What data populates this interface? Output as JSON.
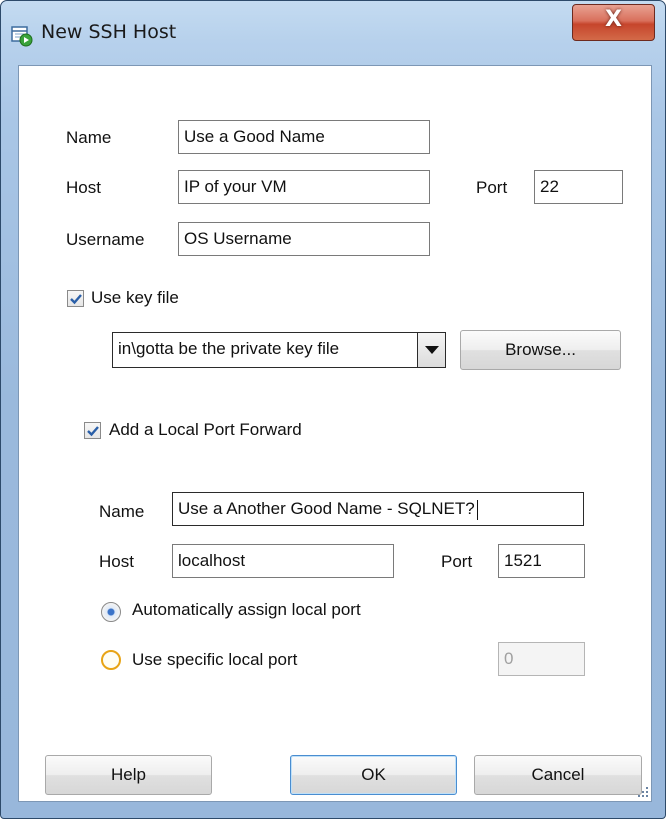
{
  "window": {
    "title": "New SSH Host",
    "close_symbol": "X"
  },
  "ssh": {
    "name_label": "Name",
    "name_value": "Use a Good Name",
    "host_label": "Host",
    "host_value": "IP of your VM",
    "port_label": "Port",
    "port_value": "22",
    "username_label": "Username",
    "username_value": "OS Username"
  },
  "key_file": {
    "checkbox_label": "Use key file",
    "checked": true,
    "path_value": "in\\gotta be the private key file",
    "browse_label": "Browse..."
  },
  "port_forward": {
    "checkbox_label": "Add a Local Port Forward",
    "checked": true,
    "name_label": "Name",
    "name_value": "Use a Another Good Name - SQLNET?",
    "host_label": "Host",
    "host_value": "localhost",
    "port_label": "Port",
    "port_value": "1521",
    "auto_port_label": "Automatically assign local port",
    "specific_port_label": "Use specific local port",
    "specific_port_value": "0",
    "selected_option": "auto"
  },
  "buttons": {
    "help": "Help",
    "ok": "OK",
    "cancel": "Cancel"
  },
  "icons": {
    "title": "ssh-host-icon",
    "close": "close-icon",
    "checkmark": "checkmark-icon",
    "dropdown": "chevron-down-icon",
    "grip": "resize-grip-icon"
  },
  "colors": {
    "frame": "#a9c6e6",
    "close_button": "#c6452c",
    "checkmark": "#2a5fa8",
    "radio_selected": "#3b73c8",
    "radio_unselected": "#e8a415"
  }
}
